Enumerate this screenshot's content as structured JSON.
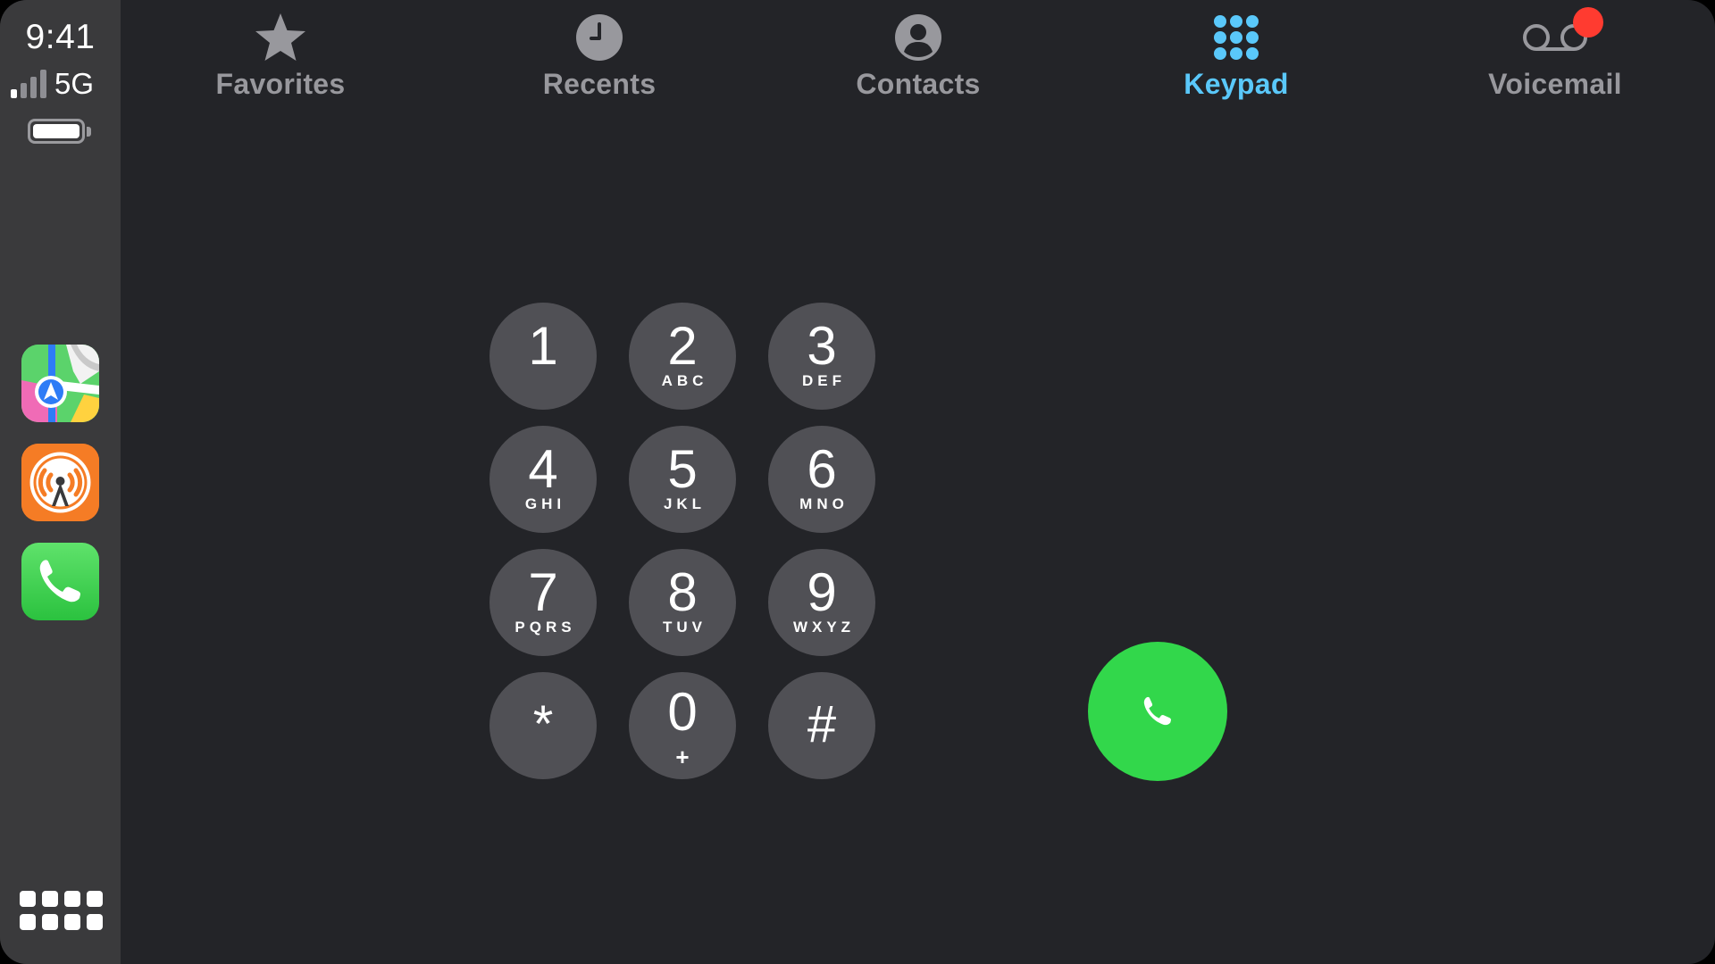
{
  "status": {
    "time": "9:41",
    "network": "5G",
    "signal_bars_active": 1,
    "signal_bars_total": 4
  },
  "sidebar": {
    "apps": [
      {
        "name": "maps-app",
        "icon": "maps-icon"
      },
      {
        "name": "overcast-app",
        "icon": "overcast-icon"
      },
      {
        "name": "phone-app",
        "icon": "phone-icon"
      }
    ],
    "dashboard_icon": "grid-icon"
  },
  "tabs": [
    {
      "label": "Favorites",
      "icon": "star-icon",
      "active": false
    },
    {
      "label": "Recents",
      "icon": "clock-icon",
      "active": false
    },
    {
      "label": "Contacts",
      "icon": "person-icon",
      "active": false
    },
    {
      "label": "Keypad",
      "icon": "keypad-icon",
      "active": true
    },
    {
      "label": "Voicemail",
      "icon": "voicemail-icon",
      "active": false,
      "badge": true
    }
  ],
  "keypad": {
    "keys": [
      {
        "digit": "1",
        "letters": ""
      },
      {
        "digit": "2",
        "letters": "ABC"
      },
      {
        "digit": "3",
        "letters": "DEF"
      },
      {
        "digit": "4",
        "letters": "GHI"
      },
      {
        "digit": "5",
        "letters": "JKL"
      },
      {
        "digit": "6",
        "letters": "MNO"
      },
      {
        "digit": "7",
        "letters": "PQRS"
      },
      {
        "digit": "8",
        "letters": "TUV"
      },
      {
        "digit": "9",
        "letters": "WXYZ"
      },
      {
        "digit": "*",
        "letters": ""
      },
      {
        "digit": "0",
        "letters": "+"
      },
      {
        "digit": "#",
        "letters": ""
      }
    ],
    "call_icon": "phone-icon"
  },
  "colors": {
    "background": "#232428",
    "sidebar": "#3a3a3c",
    "key": "#505055",
    "active_tab": "#5ac8fa",
    "inactive_tab": "#98989d",
    "call": "#32d74b",
    "badge": "#ff3b30"
  }
}
